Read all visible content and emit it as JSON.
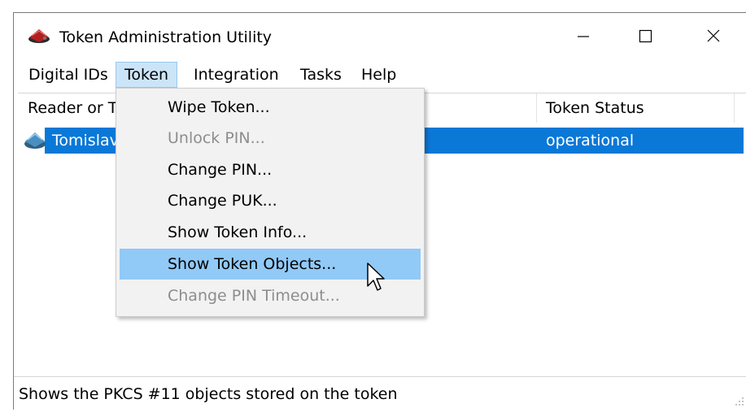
{
  "window": {
    "title": "Token Administration Utility"
  },
  "menubar": {
    "items": [
      {
        "label": "Digital IDs"
      },
      {
        "label": "Token"
      },
      {
        "label": "Integration"
      },
      {
        "label": "Tasks"
      },
      {
        "label": "Help"
      }
    ]
  },
  "list": {
    "columns": [
      {
        "label": "Reader or T"
      },
      {
        "label": "Token Status"
      }
    ],
    "rows": [
      {
        "name": "Tomislav",
        "status": "operational"
      }
    ]
  },
  "token_menu": {
    "items": [
      {
        "label": "Wipe Token...",
        "enabled": true
      },
      {
        "label": "Unlock PIN...",
        "enabled": false
      },
      {
        "label": "Change PIN...",
        "enabled": true
      },
      {
        "label": "Change PUK...",
        "enabled": true
      },
      {
        "label": "Show Token Info...",
        "enabled": true
      },
      {
        "label": "Show Token Objects...",
        "enabled": true,
        "highlighted": true
      },
      {
        "label": "Change PIN Timeout...",
        "enabled": false
      }
    ]
  },
  "statusbar": {
    "text": "Shows the PKCS #11 objects stored on the token"
  },
  "colors": {
    "selection": "#0a78d7",
    "menu_highlight": "#91c9f7",
    "active_menu": "#cce4f7"
  },
  "icons": {
    "app": "token-card-icon",
    "row": "token-card-icon"
  }
}
